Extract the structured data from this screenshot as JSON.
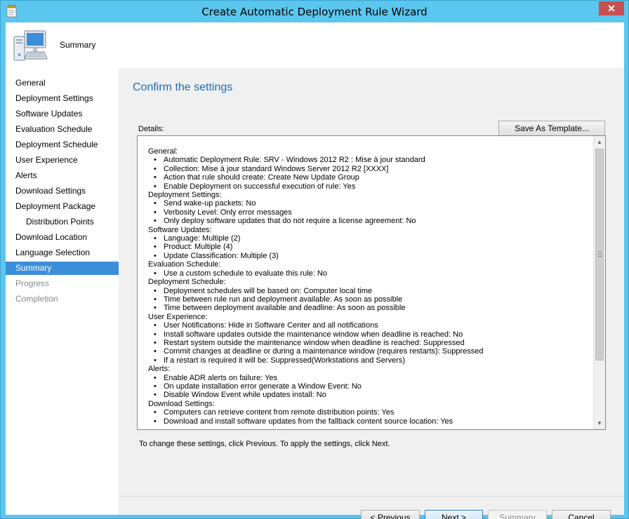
{
  "window": {
    "title": "Create Automatic Deployment Rule Wizard",
    "close_glyph": "✕"
  },
  "header": {
    "title": "Summary",
    "icon": "computer-icon"
  },
  "nav": {
    "items": [
      {
        "label": "General",
        "state": "normal",
        "sub": false
      },
      {
        "label": "Deployment Settings",
        "state": "normal",
        "sub": false
      },
      {
        "label": "Software Updates",
        "state": "normal",
        "sub": false
      },
      {
        "label": "Evaluation Schedule",
        "state": "normal",
        "sub": false
      },
      {
        "label": "Deployment Schedule",
        "state": "normal",
        "sub": false
      },
      {
        "label": "User Experience",
        "state": "normal",
        "sub": false
      },
      {
        "label": "Alerts",
        "state": "normal",
        "sub": false
      },
      {
        "label": "Download Settings",
        "state": "normal",
        "sub": false
      },
      {
        "label": "Deployment Package",
        "state": "normal",
        "sub": false
      },
      {
        "label": "Distribution Points",
        "state": "normal",
        "sub": true
      },
      {
        "label": "Download Location",
        "state": "normal",
        "sub": false
      },
      {
        "label": "Language Selection",
        "state": "normal",
        "sub": false
      },
      {
        "label": "Summary",
        "state": "active",
        "sub": false
      },
      {
        "label": "Progress",
        "state": "disabled",
        "sub": false
      },
      {
        "label": "Completion",
        "state": "disabled",
        "sub": false
      }
    ]
  },
  "main": {
    "heading": "Confirm the settings",
    "details_label": "Details:",
    "save_template_label": "Save As Template...",
    "instruction": "To change these settings, click Previous. To apply the settings, click Next.",
    "sections": [
      {
        "title": "General:",
        "items": [
          "Automatic Deployment Rule: SRV - Windows 2012 R2 : Mise à jour standard",
          "Collection: Mise à jour standard Windows Server 2012 R2 [XXXX]",
          "Action that rule should create: Create New Update Group",
          "Enable Deployment on successful execution of rule: Yes"
        ]
      },
      {
        "title": "Deployment Settings:",
        "items": [
          "Send wake-up packets: No",
          "Verbosity Level: Only error messages",
          "Only deploy software updates that do not require a license agreement: No"
        ]
      },
      {
        "title": "Software Updates:",
        "items": [
          "Language: Multiple (2)",
          "Product: Multiple (4)",
          "Update Classification: Multiple (3)"
        ]
      },
      {
        "title": "Evaluation Schedule:",
        "items": [
          "Use a custom schedule to evaluate this rule: No"
        ]
      },
      {
        "title": "Deployment Schedule:",
        "items": [
          "Deployment schedules will be based on: Computer local time",
          "Time between rule run and deployment available: As soon as possible",
          "Time between deployment available and deadline: As soon as possible"
        ]
      },
      {
        "title": "User Experience:",
        "items": [
          "User Notifications: Hide in Software Center and all notifications",
          "Install software updates outside the maintenance window when deadline is reached: No",
          "Restart system outside the maintenance window when deadline is reached: Suppressed",
          "Commit changes at deadline or during a maintenance window (requires restarts): Suppressed",
          "If a restart is required it will be: Suppressed(Workstations and Servers)"
        ]
      },
      {
        "title": "Alerts:",
        "items": [
          "Enable ADR alerts on failure: Yes",
          "On update installation error generate a Window Event: No",
          "Disable Window Event while updates install: No"
        ]
      },
      {
        "title": "Download Settings:",
        "items": [
          "Computers can retrieve content from remote distribution points: Yes",
          "Download and install software updates from the fallback content source location: Yes"
        ]
      }
    ]
  },
  "footer": {
    "previous_label": "< Previous",
    "next_label": "Next >",
    "summary_label": "Summary",
    "cancel_label": "Cancel"
  },
  "colors": {
    "frame": "#5bc6ee",
    "accent": "#3b8fd8",
    "heading": "#1a6fc0"
  }
}
